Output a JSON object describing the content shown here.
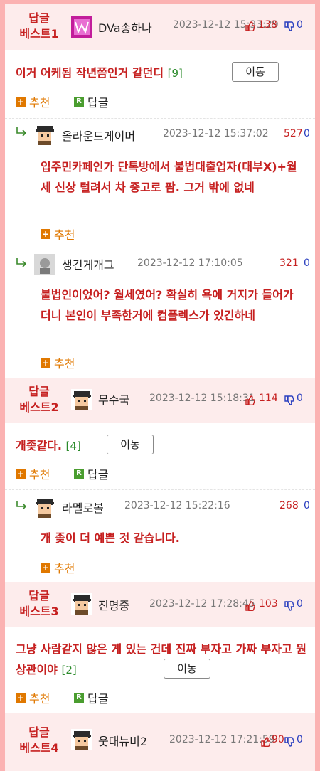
{
  "colors": {
    "accent_red": "#c62020",
    "border_pink": "#fbb2b2",
    "head_bg": "#fdecec",
    "reco_orange": "#e07800",
    "reply_green": "#4a9d2f",
    "down_blue": "#2a3fbf"
  },
  "labels": {
    "best_line1": "답글",
    "move": "이동",
    "recommend": "추천",
    "reply": "답글",
    "reply_box": "R",
    "plus": "+"
  },
  "best": [
    {
      "rank": "베스트1",
      "user": "DVa송하나",
      "date": "2023-12-12 15:33:29",
      "up": "138",
      "down": "0",
      "text": "이거 어케됨 작년쯤인거 같던디",
      "count": "[9]"
    },
    {
      "rank": "베스트2",
      "user": "무수국",
      "date": "2023-12-12 15:18:31",
      "up": "114",
      "down": "0",
      "text": "개좆같다.",
      "count": "[4]"
    },
    {
      "rank": "베스트3",
      "user": "진명중",
      "date": "2023-12-12 17:28:45",
      "up": "103",
      "down": "0",
      "text": "그냥 사람같지 않은 게 있는 건데 진짜 부자고 가짜 부자고 뭔 상관이야",
      "count": "[2]"
    },
    {
      "rank": "베스트4",
      "user": "웃대뉴비2",
      "date": "2023-12-12 17:21:59",
      "up": "90",
      "down": "0"
    }
  ],
  "replies": [
    {
      "user": "올라운드게이머",
      "date": "2023-12-12 15:37:02",
      "up": "527",
      "down": "0",
      "text": "입주민카페인가 단톡방에서 불법대출업자(대부X)+월세 신상 털려서 차 중고로 팜. 그거 밖에 없네"
    },
    {
      "user": "생긴게개그",
      "date": "2023-12-12 17:10:05",
      "up": "321",
      "down": "0",
      "text": "불법인이었어? 월세였어? 확실히 욕에 거지가 들어가더니 본인이 부족한거에 컴플렉스가 있긴하네"
    },
    {
      "user": "라멜로볼",
      "date": "2023-12-12 15:22:16",
      "up": "268",
      "down": "0",
      "text": "개 좆이 더 예쁜 것 같습니다."
    }
  ]
}
